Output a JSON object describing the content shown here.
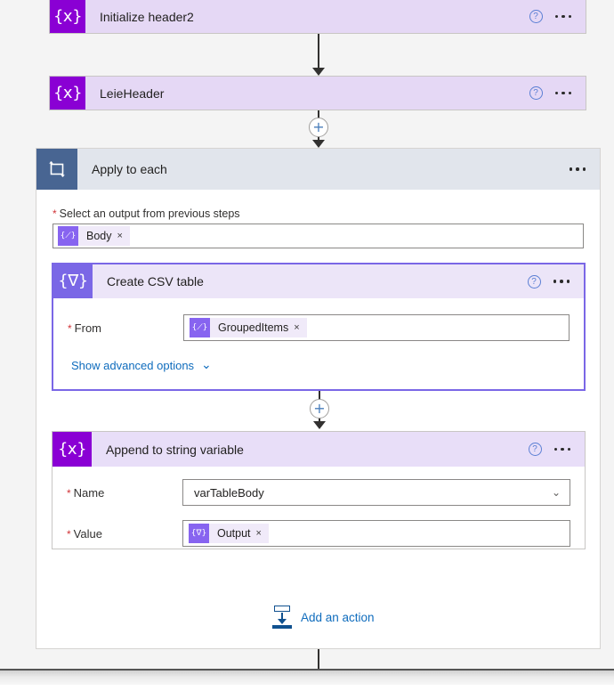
{
  "flow": {
    "steps": [
      {
        "id": "initialize-header2",
        "title": "Initialize header2",
        "icon": "variable-braces-x-icon",
        "icon_glyph": "{x}",
        "help_glyph": "?",
        "icon_color": "#8a00d4"
      },
      {
        "id": "leieheader",
        "title": "LeieHeader",
        "icon": "variable-braces-x-icon",
        "icon_glyph": "{x}",
        "help_glyph": "?",
        "icon_color": "#8a00d4"
      }
    ],
    "loop": {
      "id": "apply-to-each",
      "title": "Apply to each",
      "icon": "loop-apply-to-each-icon",
      "icon_color": "#486592",
      "output_field": {
        "label": "Select an output from previous steps",
        "required_marker": "*",
        "token": {
          "label": "Body",
          "icon_glyph": "{⟋}",
          "remove_glyph": "×"
        }
      },
      "children": [
        {
          "id": "create-csv-table",
          "title": "Create CSV table",
          "icon": "data-operations-funnel-icon",
          "icon_glyph": "{∇}",
          "icon_color": "#7a67e6",
          "help_glyph": "?",
          "selected": true,
          "fields": [
            {
              "label": "From",
              "required_marker": "*",
              "type": "token",
              "token": {
                "label": "GroupedItems",
                "icon_glyph": "{⟋}",
                "remove_glyph": "×"
              }
            }
          ],
          "advanced_link": {
            "label": "Show advanced options",
            "chevron": "⌄"
          }
        },
        {
          "id": "append-to-string-variable",
          "title": "Append to string variable",
          "icon": "variable-braces-x-icon",
          "icon_glyph": "{x}",
          "icon_color": "#8a00d4",
          "help_glyph": "?",
          "selected": false,
          "fields": [
            {
              "label": "Name",
              "required_marker": "*",
              "type": "dropdown",
              "value": "varTableBody",
              "chevron": "⌄"
            },
            {
              "label": "Value",
              "required_marker": "*",
              "type": "token",
              "token": {
                "label": "Output",
                "icon_glyph": "{∇}",
                "remove_glyph": "×"
              }
            }
          ]
        }
      ],
      "add_action": {
        "label": "Add an action",
        "icon": "add-an-action-icon",
        "color": "#0f6cbd"
      }
    },
    "connectors": {
      "plus_glyph": "+"
    }
  }
}
